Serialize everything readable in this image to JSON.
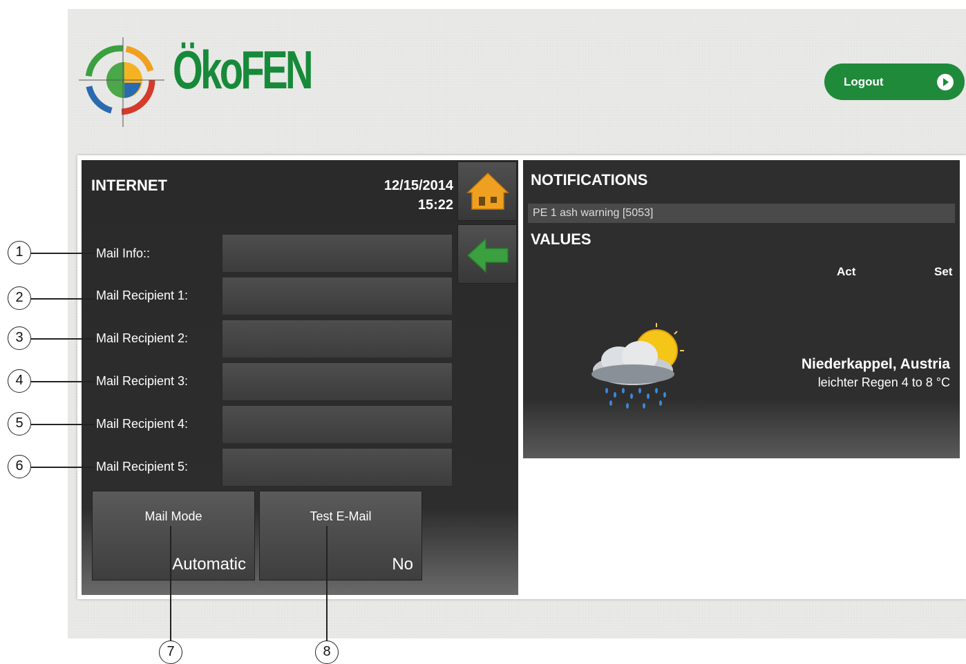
{
  "header": {
    "brand": "ÖkoFEN",
    "logout_label": "Logout"
  },
  "left_panel": {
    "title": "INTERNET",
    "date": "12/15/2014",
    "time": "15:22",
    "fields": [
      {
        "label": "Mail Info::",
        "value": ""
      },
      {
        "label": "Mail Recipient 1:",
        "value": ""
      },
      {
        "label": "Mail Recipient 2:",
        "value": ""
      },
      {
        "label": "Mail Recipient 3:",
        "value": ""
      },
      {
        "label": "Mail Recipient 4:",
        "value": ""
      },
      {
        "label": "Mail Recipient 5:",
        "value": ""
      }
    ],
    "mail_mode": {
      "label": "Mail Mode",
      "value": "Automatic"
    },
    "test_email": {
      "label": "Test E-Mail",
      "value": "No"
    }
  },
  "right_panel": {
    "notifications_title": "NOTIFICATIONS",
    "notifications": [
      "PE 1 ash warning [5053]"
    ],
    "values_title": "VALUES",
    "col_act": "Act",
    "col_set": "Set",
    "weather": {
      "location": "Niederkappel, Austria",
      "condition": "leichter Regen 4 to 8 °C",
      "icon": "rain-cloud-sun-icon"
    }
  },
  "callouts": [
    "1",
    "2",
    "3",
    "4",
    "5",
    "6",
    "7",
    "8"
  ],
  "colors": {
    "brand_green": "#178a3a",
    "logout_green": "#1f8a3a",
    "panel_dark": "#2d2d2d",
    "home_orange": "#f0a020",
    "back_green": "#3aa040"
  }
}
